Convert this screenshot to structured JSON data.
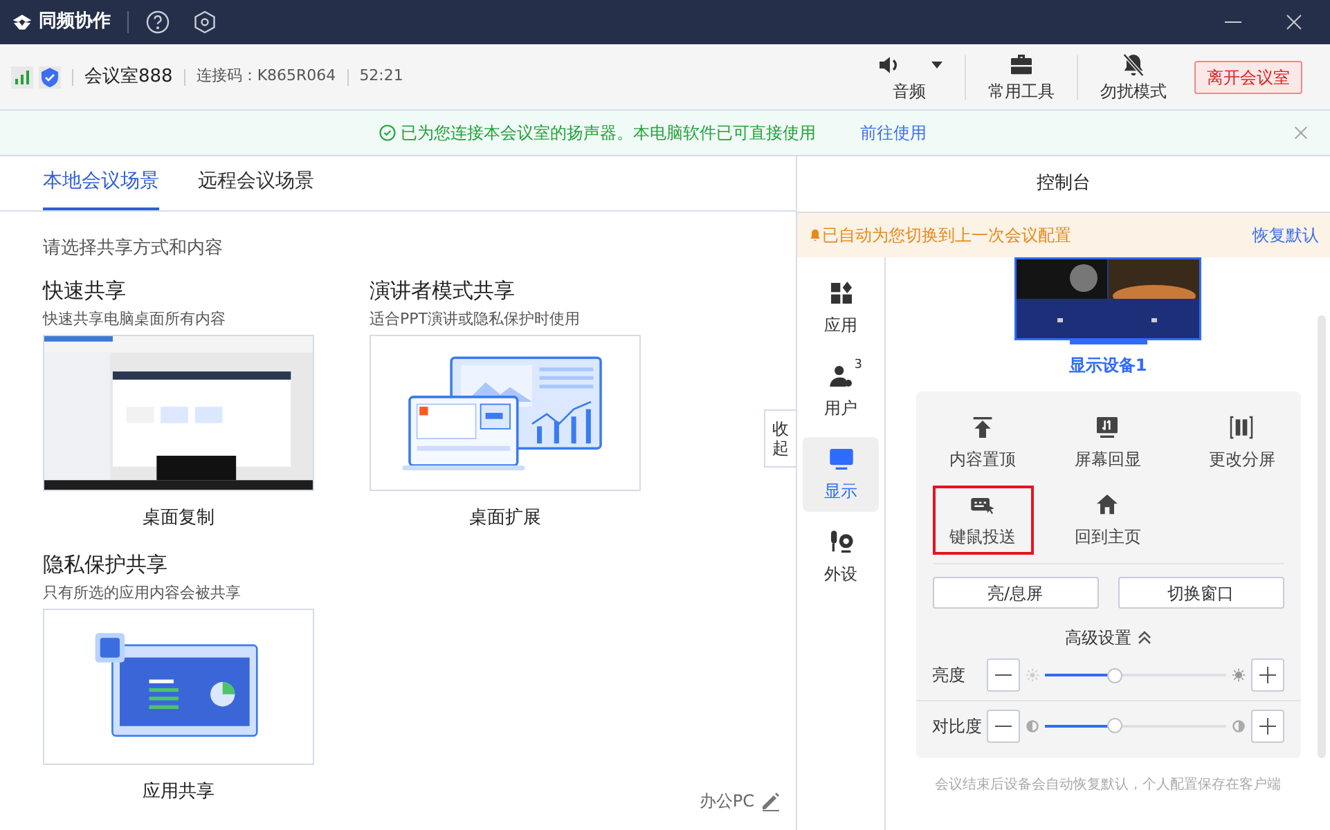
{
  "app": {
    "name": "同频协作"
  },
  "info": {
    "room": "会议室888",
    "code": "连接码：K865R064",
    "timer": "52:21"
  },
  "toolbar": [
    {
      "label": "音频",
      "kind": "audio"
    },
    {
      "label": "常用工具",
      "kind": "tools"
    },
    {
      "label": "勿扰模式",
      "kind": "dnd"
    }
  ],
  "leave_button": "离开会议室",
  "notice": {
    "text": "已为您连接本会议室的扬声器。本电脑软件已可直接使用",
    "link": "前往使用"
  },
  "tabs": [
    {
      "label": "本地会议场景",
      "selected": true
    },
    {
      "label": "远程会议场景",
      "selected": false
    }
  ],
  "prompt": "请选择共享方式和内容",
  "share_options": [
    {
      "title": "快速共享",
      "desc": "快速共享电脑桌面所有内容",
      "caption": "桌面复制",
      "kind": "screenshot"
    },
    {
      "title": "演讲者模式共享",
      "desc": "适合PPT演讲或隐私保护时使用",
      "caption": "桌面扩展",
      "kind": "extend"
    },
    {
      "title": "隐私保护共享",
      "desc": "只有所选的应用内容会被共享",
      "caption": "应用共享",
      "kind": "app"
    }
  ],
  "collapse": "收起",
  "device_name": "办公PC",
  "console": {
    "title": "控制台",
    "alert": "已自动为您切换到上一次会议配置",
    "restore": "恢复默认",
    "nav": [
      {
        "label": "应用",
        "kind": "apps",
        "selected": false
      },
      {
        "label": "用户",
        "kind": "users",
        "badge": "3",
        "selected": false
      },
      {
        "label": "显示",
        "kind": "display",
        "selected": true
      },
      {
        "label": "外设",
        "kind": "peripherals",
        "selected": false
      }
    ],
    "display_name": "显示设备1",
    "actions": [
      {
        "label": "内容置顶",
        "kind": "pin",
        "highlighted": false
      },
      {
        "label": "屏幕回显",
        "kind": "echo",
        "highlighted": false
      },
      {
        "label": "更改分屏",
        "kind": "split",
        "highlighted": false
      },
      {
        "label": "键鼠投送",
        "kind": "keyboard",
        "highlighted": true
      },
      {
        "label": "回到主页",
        "kind": "home",
        "highlighted": false
      }
    ],
    "buttons": [
      "亮/息屏",
      "切换窗口"
    ],
    "advanced": {
      "label": "高级设置",
      "expanded": true
    },
    "sliders": [
      {
        "label": "亮度",
        "kind": "brightness",
        "level": 0.38
      },
      {
        "label": "对比度",
        "kind": "contrast",
        "level": 0.38
      }
    ],
    "footer": "会议结束后设备会自动恢复默认，个人配置保存在客户端"
  }
}
